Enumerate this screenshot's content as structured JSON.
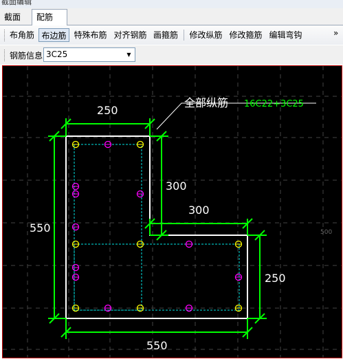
{
  "window": {
    "title": "截面编辑"
  },
  "tabs": [
    {
      "label": "截面",
      "active": false
    },
    {
      "label": "配筋",
      "active": true
    }
  ],
  "toolbar": {
    "buttons": [
      {
        "label": "布角筋"
      },
      {
        "label": "布边筋",
        "pressed": true
      },
      {
        "label": "特殊布筋"
      },
      {
        "label": "对齐钢筋"
      },
      {
        "label": "画箍筋"
      },
      {
        "label": "修改纵筋"
      },
      {
        "label": "修改箍筋"
      },
      {
        "label": "编辑弯钩"
      }
    ],
    "overflow": "»"
  },
  "rebar_info": {
    "label": "钢筋信息",
    "value": "3C25"
  },
  "drawing": {
    "colors": {
      "background": "#000000",
      "outline": "#ffffff",
      "dimension": "#00ff00",
      "stirrup": "#00e5e5",
      "corner_bar": "#ffff00",
      "side_bar": "#ff00ff",
      "border": "#c00000"
    },
    "dimensions": {
      "top_width": "250",
      "notch_height": "300",
      "notch_width": "300",
      "left_height": "550",
      "right_height": "250",
      "bottom_width": "550"
    },
    "annotation": {
      "label": "全部纵筋",
      "value": "16C22+3C25"
    },
    "grid_label": "500"
  }
}
